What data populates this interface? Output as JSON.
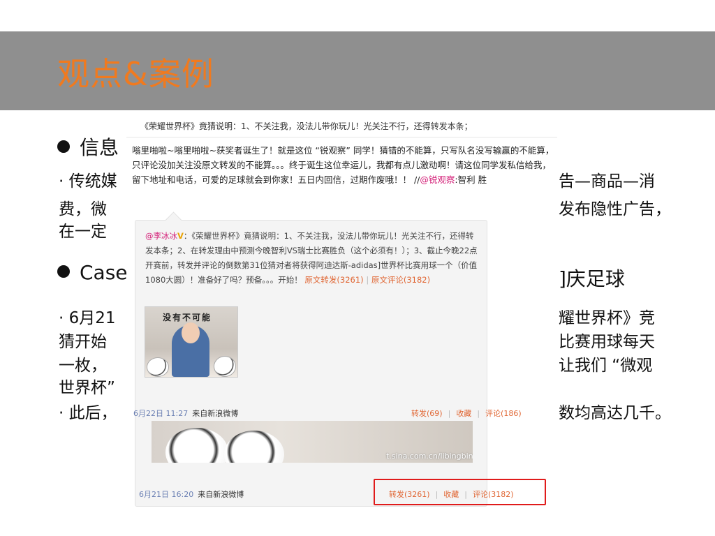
{
  "slide": {
    "title": "观点&案例",
    "bullet1": "信息",
    "line1_left": "· 传统媒",
    "line1_right": "告—商品—消",
    "line2_left": "费，微",
    "line2_right": "发布隐性广告，",
    "line3_left": "在一定",
    "bullet2": "Case",
    "bullet2_right": "]庆足球",
    "line4_left": "· 6月21",
    "line4_right": "耀世界杯》竞",
    "line5_left": "猜开始",
    "line5_right": "比赛用球每天",
    "line6_left": "一枚，",
    "line6_right": "让我们 “微观",
    "line7_left": "世界杯”",
    "line8_left": "· 此后，",
    "line8_right": "数均高达几千。"
  },
  "weibo": {
    "top_line": "《荣耀世界杯》竟猜说明：1、不关注我，没法儿带你玩儿！光关注不行，还得转发本条；",
    "post_text": "嗡里啪啦~嗡里啪啦~获奖者诞生了！就是这位 “锐观察” 同学！猜错的不能算，只写队名没写输赢的不能算，只评论没加关注没原文转发的不能算。。。终于诞生这位幸运儿，我都有点儿激动啊！请这位同学发私信给我，留下地址和电话，可爱的足球就会到你家！五日内回信，过期作废哦！！ //",
    "post_mention": "@锐观察",
    "post_tail": ":智利 胜",
    "repost_author": "@李冰冰",
    "repost_badge": "V",
    "repost_text": "：《荣耀世界杯》竟猜说明：1、不关注我，没法儿带你玩儿！光关注不行，还得转发本条；2、在转发理由中预测今晚智利VS瑞士比赛胜负（这个必须有！）；3、截止今晚22点开赛前，转发并评论的倒数第31位猜对者将获得阿迪达斯-adidas]世界杯比赛用球一个（价值1080大圆）！准备好了吗？预备。。。开始！",
    "repost_forward": "原文转发(3261)",
    "repost_sep": "|",
    "repost_comment": "原文评论(3182)",
    "thumb_caption": "没有不可能",
    "watermark": "t.sina.com.cn/libingbing",
    "meta1_time": "6月22日 11:27",
    "meta1_source": "来自新浪微博",
    "meta1_forward": "转发(69)",
    "meta1_fav": "收藏",
    "meta1_comment": "评论(186)",
    "meta2_time": "6月21日 16:20",
    "meta2_source": "来自新浪微博",
    "meta2_forward": "转发(3261)",
    "meta2_fav": "收藏",
    "meta2_comment": "评论(3182)",
    "sep": "|"
  },
  "colors": {
    "title": "#f07a1f",
    "title_bar": "#8f8f8f",
    "link": "#d4237a",
    "action": "#e06633",
    "highlight_box": "#e01b1b"
  }
}
